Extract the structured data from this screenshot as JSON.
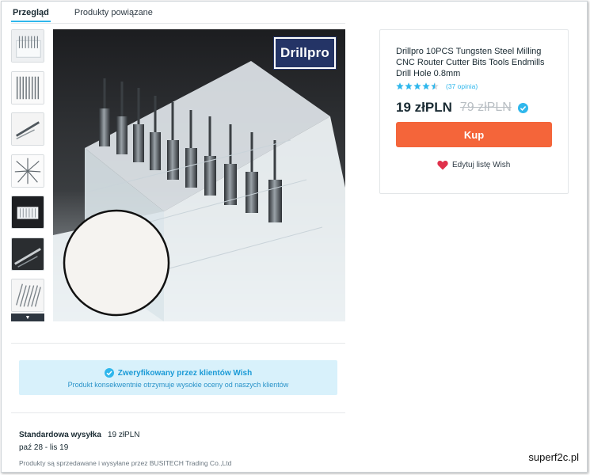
{
  "tabs": [
    {
      "label": "Przegląd",
      "active": true
    },
    {
      "label": "Produkty powiązane",
      "active": false
    }
  ],
  "product": {
    "title": "Drillpro 10PCS Tungsten Steel Milling CNC Router Cutter Bits Tools Endmills Drill Hole 0.8mm",
    "brand_logo_text": "Drillpro",
    "rating": 4.5,
    "rating_max": 5,
    "reviews_text": "(37 opinia)",
    "price": "19 złPLN",
    "original_price": "79 złPLN",
    "buy_label": "Kup",
    "wishlist_label": "Edytuj listę Wish"
  },
  "thumbnails": [
    {
      "icon": "drill-bits-case-thumb"
    },
    {
      "icon": "drill-bits-row-thumb"
    },
    {
      "icon": "drill-bit-single-thumb"
    },
    {
      "icon": "drill-bits-fan-thumb"
    },
    {
      "icon": "drill-box-thumb"
    },
    {
      "icon": "drill-bit-closeup-thumb"
    },
    {
      "icon": "drill-bits-set-thumb"
    }
  ],
  "verified": {
    "title": "Zweryfikowany przez klientów Wish",
    "subtitle": "Produkt konsekwentnie otrzymuje wysokie oceny od naszych klientów"
  },
  "shipping": {
    "label": "Standardowa wysyłka",
    "price": "19 złPLN",
    "dates": "paź 28 - lis 19"
  },
  "seller_text": "Produkty są sprzedawane i wysyłane przez BUSITECH Trading Co.,Ltd",
  "watermark": "superf2c.pl",
  "colors": {
    "accent": "#2fb7ec",
    "buy_button": "#f4653a",
    "heart": "#e0314b",
    "verified_bg": "#d8f1fb"
  }
}
